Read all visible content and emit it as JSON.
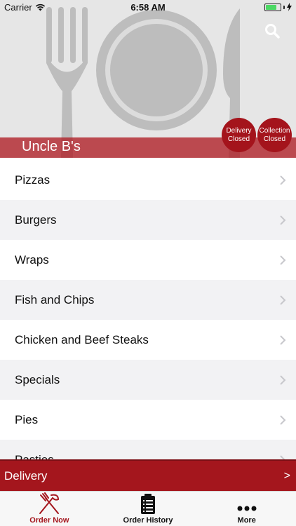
{
  "status_bar": {
    "carrier": "Carrier",
    "time": "6:58 AM",
    "battery_level": 0.75,
    "wifi_icon": "wifi-icon",
    "charging_icon": "bolt-icon"
  },
  "header": {
    "restaurant_name": "Uncle B's",
    "search_icon": "search-icon",
    "badges": {
      "delivery": {
        "line1": "Delivery",
        "line2": "Closed"
      },
      "collection": {
        "line1": "Collection",
        "line2": "Closed"
      }
    }
  },
  "menu": {
    "items": [
      {
        "label": "Pizzas"
      },
      {
        "label": "Burgers"
      },
      {
        "label": "Wraps"
      },
      {
        "label": "Fish and Chips"
      },
      {
        "label": "Chicken and Beef Steaks"
      },
      {
        "label": "Specials"
      },
      {
        "label": "Pies"
      },
      {
        "label": "Pasties"
      }
    ]
  },
  "delivery_bar": {
    "label": "Delivery",
    "arrow": ">"
  },
  "tabs": [
    {
      "label": "Order Now",
      "icon": "fork-knife-icon",
      "active": true
    },
    {
      "label": "Order History",
      "icon": "clipboard-icon",
      "active": false
    },
    {
      "label": "More",
      "icon": "ellipsis-icon",
      "active": false
    }
  ],
  "colors": {
    "brand": "#a4161d",
    "header_bg": "#e6e6e6",
    "battery": "#4cd964"
  }
}
